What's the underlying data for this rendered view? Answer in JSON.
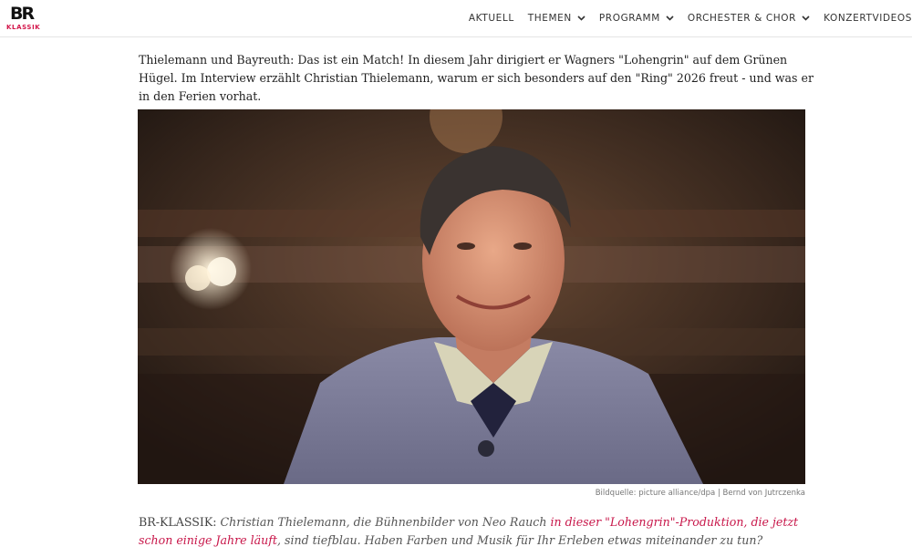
{
  "header": {
    "logo_br": "BR",
    "logo_klassik": "KLASSIK",
    "nav": [
      {
        "label": "AKTUELL",
        "has_dropdown": false
      },
      {
        "label": "THEMEN",
        "has_dropdown": true
      },
      {
        "label": "PROGRAMM",
        "has_dropdown": true
      },
      {
        "label": "ORCHESTER & CHOR",
        "has_dropdown": true
      },
      {
        "label": "KONZERTVIDEOS",
        "has_dropdown": false
      }
    ]
  },
  "article": {
    "lead": "Thielemann und Bayreuth: Das ist ein Match! In diesem Jahr dirigiert er Wagners \"Lohengrin\" auf dem Grünen Hügel. Im Interview erzählt Christian Thielemann, warum er sich besonders auf den \"Ring\" 2026 freut - und was er in den Ferien vorhat.",
    "image_caption": "Bildquelle: picture alliance/dpa | Bernd von Jutrczenka",
    "interview": {
      "speaker": "BR-KLASSIK:",
      "question_start": "Christian Thielemann, die Bühnenbilder von Neo Rauch",
      "link_text": "in dieser \"Lohengrin\"-Produktion, die jetzt schon einige Jahre läuft",
      "question_end": ", sind tiefblau. Haben Farben und Musik für Ihr Erleben etwas miteinander zu tun?"
    }
  },
  "colors": {
    "brand_red": "#d3164a",
    "link_red": "#c8174a",
    "text": "#1f1f1f"
  }
}
